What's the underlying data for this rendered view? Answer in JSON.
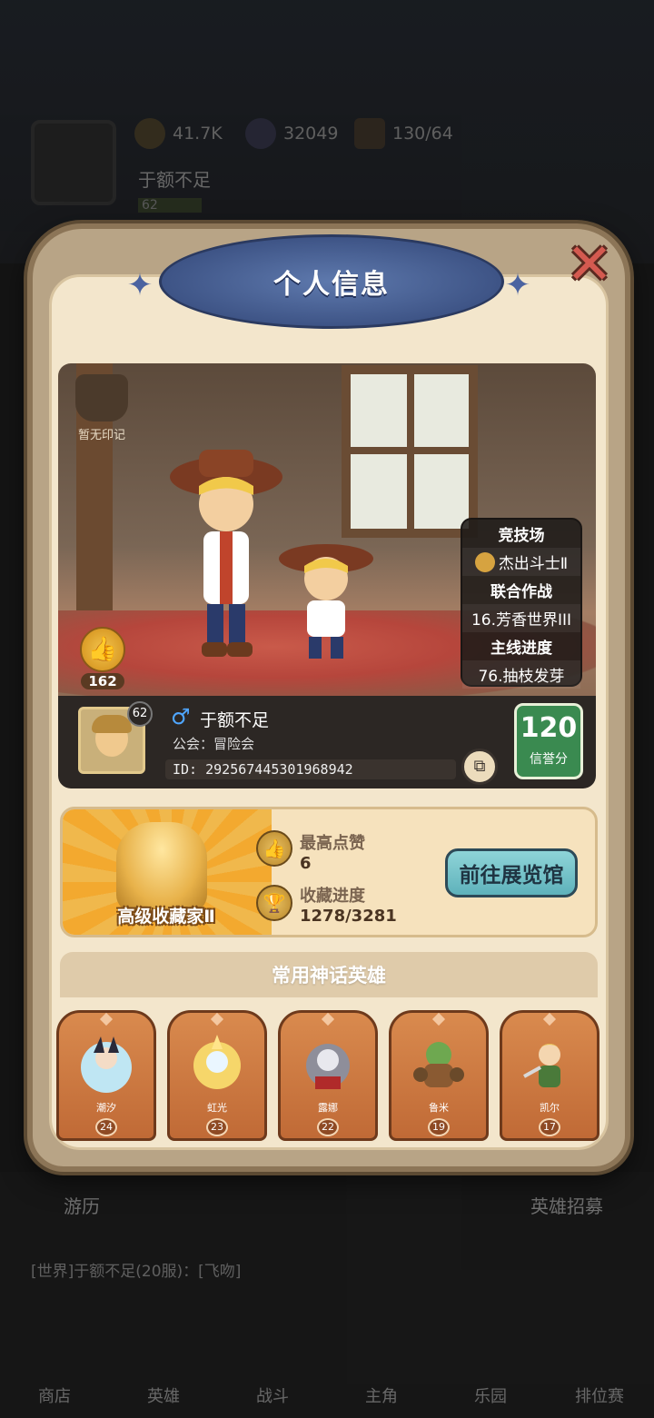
{
  "background": {
    "gold": "41.7K",
    "gems": "32049",
    "stamina": "130/64",
    "player_name": "于额不足",
    "player_level": "62",
    "travel_label": "游历",
    "recruit_label": "英雄招募",
    "chat": "[世界]于额不足(20服)：[飞吻]",
    "nav": [
      "商店",
      "英雄",
      "战斗",
      "主角",
      "乐园",
      "排位赛"
    ]
  },
  "panel": {
    "title": "个人信息",
    "no_mark": "暂无印记",
    "likes": "162",
    "info": {
      "arena_label": "竞技场",
      "arena_value": "杰出斗士Ⅱ",
      "joint_label": "联合作战",
      "joint_value": "16.芳香世界III",
      "main_label": "主线进度",
      "main_value": "76.抽枝发芽"
    },
    "player": {
      "level": "62",
      "gender": "♂",
      "name": "于额不足",
      "guild": "公会：冒险会",
      "id": "ID: 292567445301968942",
      "credit_value": "120",
      "credit_label": "信誉分"
    },
    "collector": {
      "title": "高级收藏家Ⅱ",
      "top_likes_label": "最高点赞",
      "top_likes_value": "6",
      "progress_label": "收藏进度",
      "progress_value": "1278/3281",
      "museum_button": "前往展览馆"
    },
    "heroes_title": "常用神话英雄",
    "heroes": [
      {
        "name": "潮汐",
        "level": "24"
      },
      {
        "name": "虹光",
        "level": "23"
      },
      {
        "name": "露娜",
        "level": "22"
      },
      {
        "name": "鲁米",
        "level": "19"
      },
      {
        "name": "凯尔",
        "level": "17"
      }
    ]
  },
  "colors": {
    "panel_bg": "#f3e6cc",
    "banner_blue": "#4d65a0",
    "credit_green": "#3a8a50",
    "museum_btn": "#6fc0c8",
    "hero_card": "#c9763f",
    "gender_blue": "#4fa6ff"
  }
}
